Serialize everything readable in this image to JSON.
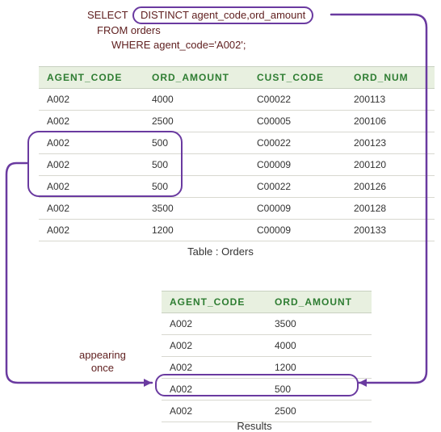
{
  "sql": {
    "select_kw": "SELECT",
    "distinct_clause": "DISTINCT agent_code,ord_amount",
    "from_line": "FROM orders",
    "where_line": "WHERE agent_code='A002';"
  },
  "orders_table": {
    "headers": [
      "AGENT_CODE",
      "ORD_AMOUNT",
      "CUST_CODE",
      "ORD_NUM"
    ],
    "rows": [
      [
        "A002",
        "4000",
        "C00022",
        "200113"
      ],
      [
        "A002",
        "2500",
        "C00005",
        "200106"
      ],
      [
        "A002",
        "500",
        "C00022",
        "200123"
      ],
      [
        "A002",
        "500",
        "C00009",
        "200120"
      ],
      [
        "A002",
        "500",
        "C00022",
        "200126"
      ],
      [
        "A002",
        "3500",
        "C00009",
        "200128"
      ],
      [
        "A002",
        "1200",
        "C00009",
        "200133"
      ]
    ],
    "caption": "Table : Orders"
  },
  "results_table": {
    "headers": [
      "AGENT_CODE",
      "ORD_AMOUNT"
    ],
    "rows": [
      [
        "A002",
        "3500"
      ],
      [
        "A002",
        "4000"
      ],
      [
        "A002",
        "1200"
      ],
      [
        "A002",
        "500"
      ],
      [
        "A002",
        "2500"
      ]
    ],
    "caption": "Results"
  },
  "annotations": {
    "appearing_line1": "appearing",
    "appearing_line2": "once"
  },
  "colors": {
    "text_maroon": "#602020",
    "bubble_purple": "#6a3aa0",
    "header_green": "#2e7d32",
    "header_bg": "#e8f0e0"
  }
}
